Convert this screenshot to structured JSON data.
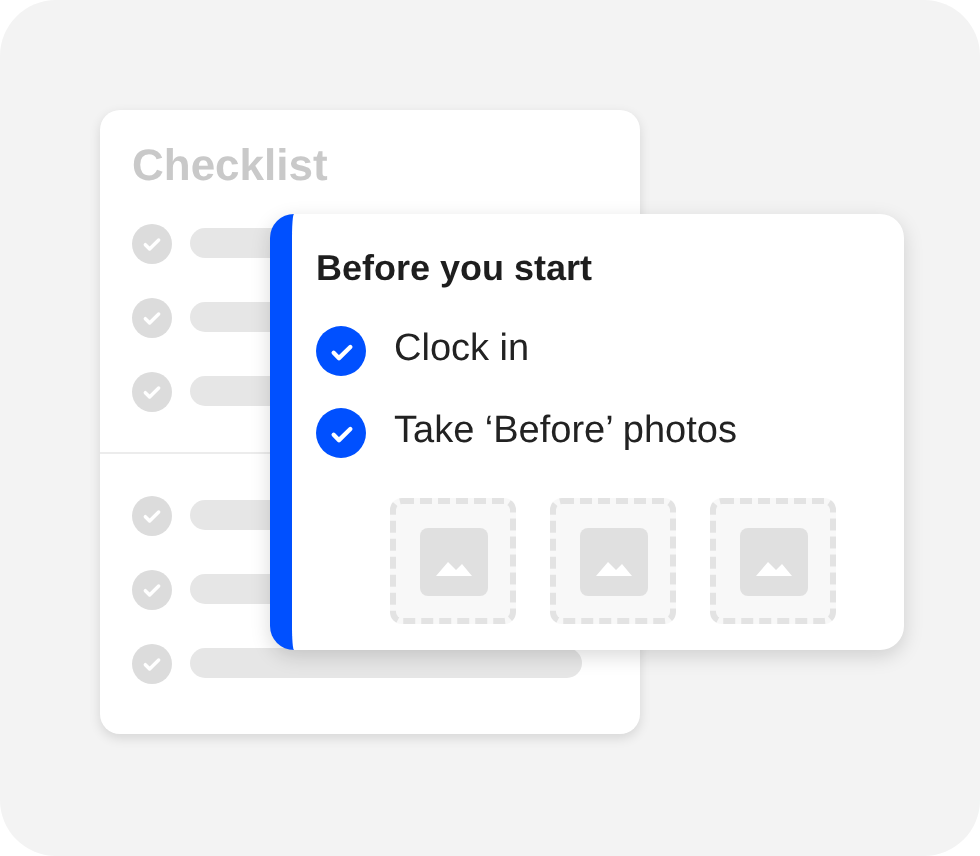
{
  "checklist": {
    "title": "Checklist",
    "sections": [
      {
        "rows": [
          {
            "kind": "skeleton"
          },
          {
            "kind": "skeleton"
          },
          {
            "kind": "skeleton"
          }
        ]
      },
      {
        "rows": [
          {
            "kind": "skeleton"
          },
          {
            "kind": "skeleton"
          },
          {
            "kind": "skeleton"
          }
        ]
      }
    ]
  },
  "task_card": {
    "title": "Before you start",
    "items": [
      {
        "label": "Clock in",
        "checked": true
      },
      {
        "label": "Take ‘Before’ photos",
        "checked": true
      }
    ],
    "photos": [
      {
        "kind": "placeholder"
      },
      {
        "kind": "placeholder"
      },
      {
        "kind": "placeholder"
      }
    ]
  }
}
